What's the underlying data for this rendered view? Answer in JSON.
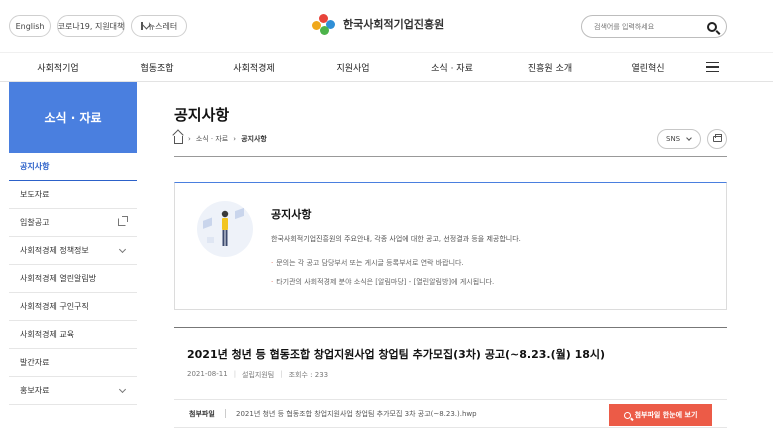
{
  "utility": {
    "lang": "English",
    "corona": "코로나19, 지원대책",
    "newsletter": "뉴스레터"
  },
  "site": {
    "name": "한국사회적기업진흥원"
  },
  "search": {
    "placeholder": "검색어를 입력하세요"
  },
  "gnb": [
    "사회적기업",
    "협동조합",
    "사회적경제",
    "지원사업",
    "소식 · 자료",
    "진흥원 소개",
    "열린혁신"
  ],
  "sidebar": {
    "title": "소식 · 자료",
    "items": [
      {
        "label": "공지사항"
      },
      {
        "label": "보도자료"
      },
      {
        "label": "입찰공고"
      },
      {
        "label": "사회적경제 정책정보"
      },
      {
        "label": "사회적경제 열린알림방"
      },
      {
        "label": "사회적경제 구인구직"
      },
      {
        "label": "사회적경제 교육"
      },
      {
        "label": "발간자료"
      },
      {
        "label": "홍보자료"
      }
    ]
  },
  "page": {
    "title": "공지사항",
    "breadcrumb": [
      "소식 · 자료",
      "공지사항"
    ],
    "sns_label": "SNS"
  },
  "info": {
    "title": "공지사항",
    "desc": "한국사회적기업진흥원의 주요안내, 각종 사업에 대한 공고, 선정결과 등을 제공합니다.",
    "bullet1": "문의는 각 공고 담당부서 또는 게시글 등록부서로 연락 바랍니다.",
    "bullet2": "타기관의 사회적경제 분야 소식은 [알림마당] - [열린알림방]에 게시됩니다."
  },
  "post": {
    "title": "2021년 청년 등 협동조합 창업지원사업 창업팀 추가모집(3차) 공고(~8.23.(월) 18시)",
    "date": "2021-08-11",
    "dept": "설립지원팀",
    "views": "조회수 : 233",
    "file_label": "첨부파일",
    "file_name": "2021년 청년 등 협동조합 창업지원사업 창업팀 추가모집 3차 공고(~8.23.).hwp",
    "view_button": "첨부파일 한눈에 보기"
  },
  "colors": {
    "accent": "#4a7fdf",
    "button": "#ec5b47"
  }
}
